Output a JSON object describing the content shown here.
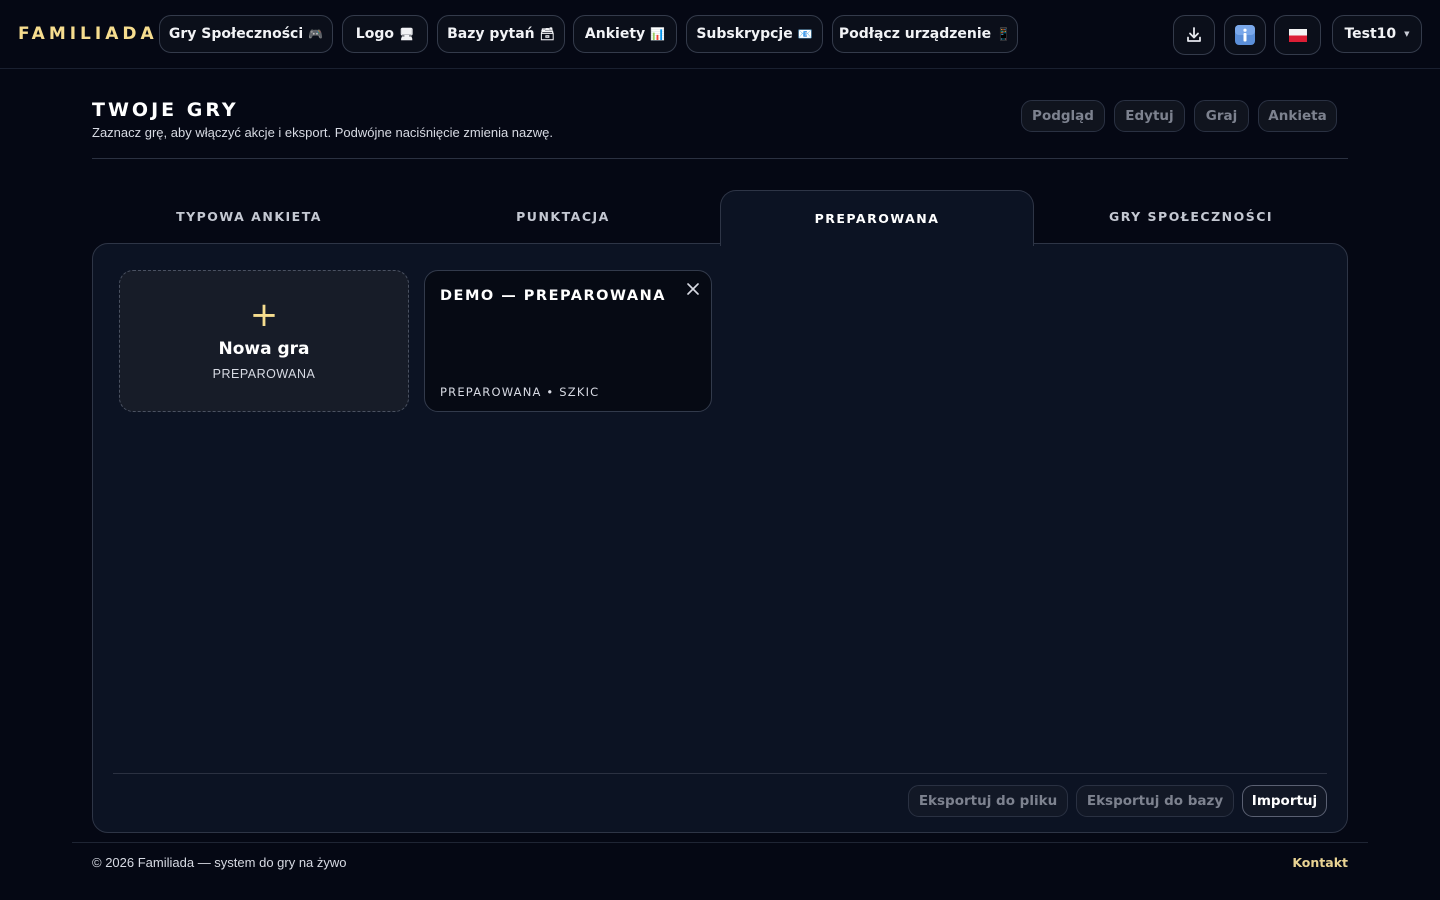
{
  "brand": "FAMILIADA",
  "nav": [
    {
      "label": "Gry Społeczności",
      "icon": "🎮"
    },
    {
      "label": "Logo",
      "icon": "🖥"
    },
    {
      "label": "Bazy pytań",
      "icon": "🗃"
    },
    {
      "label": "Ankiety",
      "icon": "📊"
    },
    {
      "label": "Subskrypcje",
      "icon": "📧"
    },
    {
      "label": "Podłącz urządzenie",
      "icon": "📱"
    }
  ],
  "topRight": {
    "download_icon": "download-icon",
    "info_icon": "info-icon",
    "language_icon": "flag-pl-icon",
    "user": "Test10"
  },
  "page": {
    "title": "TWOJE GRY",
    "subtitle": "Zaznacz grę, aby włączyć akcje i eksport. Podwójne naciśnięcie zmienia nazwę.",
    "actions": [
      "Podgląd",
      "Edytuj",
      "Graj",
      "Ankieta"
    ]
  },
  "tabs": [
    "TYPOWA ANKIETA",
    "PUNKTACJA",
    "PREPAROWANA",
    "GRY SPOŁECZNOŚCI"
  ],
  "activeTab": "PREPAROWANA",
  "newGame": {
    "title": "Nowa gra",
    "subtitle": "PREPAROWANA"
  },
  "games": [
    {
      "title": "DEMO — PREPAROWANA",
      "meta": "PREPAROWANA • SZKIC"
    }
  ],
  "panelActions": {
    "export_file": "Eksportuj do pliku",
    "export_db": "Eksportuj do bazy",
    "import": "Importuj"
  },
  "footer": {
    "copyright": "© 2026 Familiada — system do gry na żywo",
    "contact": "Kontakt"
  },
  "colors": {
    "background": "#050814",
    "panel": "#0c1323",
    "accent": "#f6dd8f",
    "border": "#2e3546"
  }
}
